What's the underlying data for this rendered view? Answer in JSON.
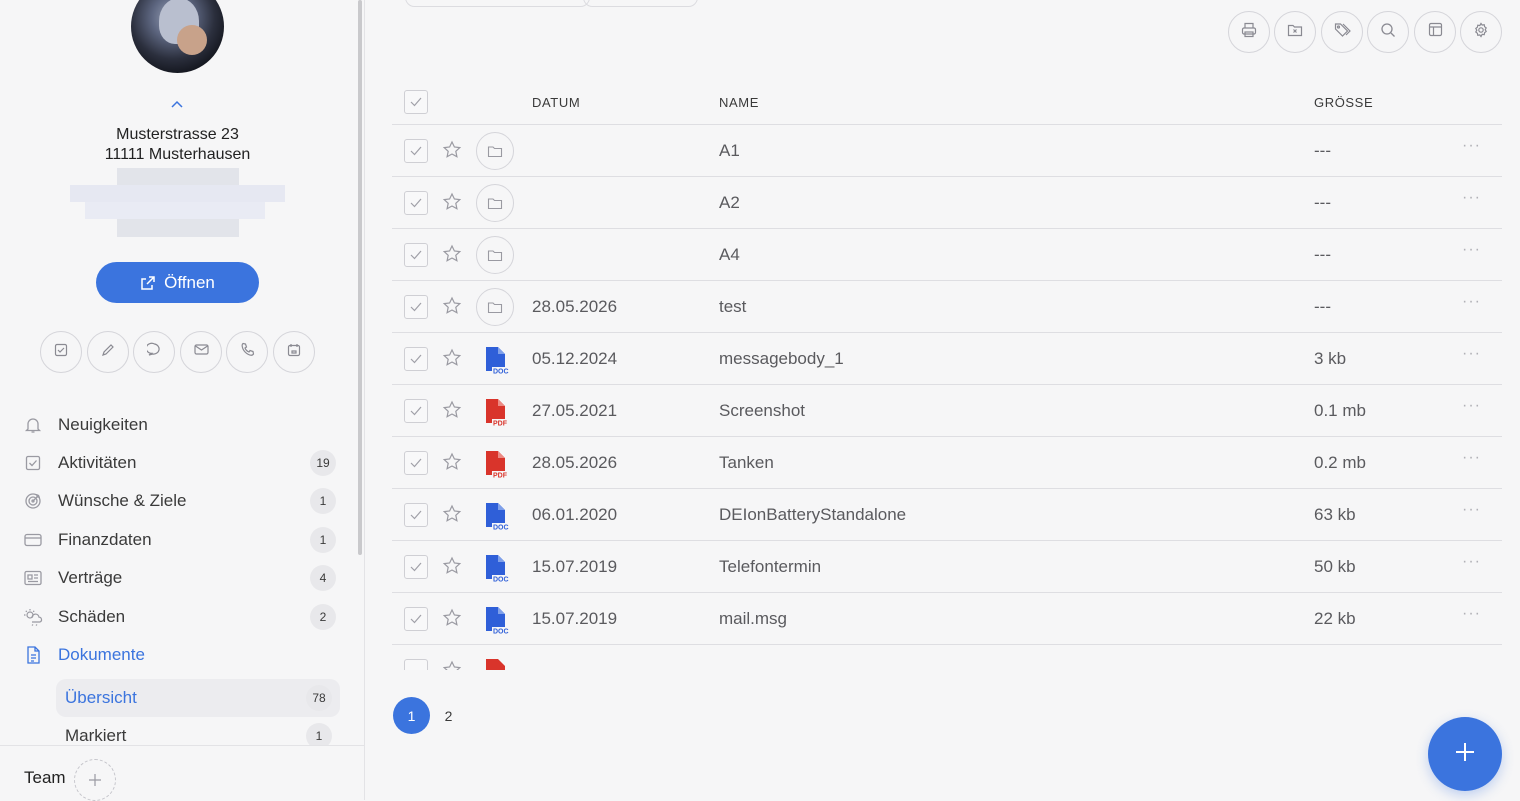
{
  "contact": {
    "address_line1": "Musterstrasse 23",
    "address_line2": "11111 Musterhausen",
    "open_button": "Öffnen"
  },
  "quick_actions": [
    "check-icon",
    "pencil-icon",
    "chat-icon",
    "mail-icon",
    "phone-icon",
    "calendar-icon"
  ],
  "nav": {
    "items": [
      {
        "label": "Neuigkeiten",
        "icon": "bell-icon",
        "badge": ""
      },
      {
        "label": "Aktivitäten",
        "icon": "checkbox-icon",
        "badge": "19"
      },
      {
        "label": "Wünsche & Ziele",
        "icon": "target-icon",
        "badge": "1"
      },
      {
        "label": "Finanzdaten",
        "icon": "card-icon",
        "badge": "1"
      },
      {
        "label": "Verträge",
        "icon": "contract-icon",
        "badge": "4"
      },
      {
        "label": "Schäden",
        "icon": "weather-icon",
        "badge": "2"
      },
      {
        "label": "Dokumente",
        "icon": "document-icon",
        "badge": ""
      }
    ],
    "sub_items": [
      {
        "label": "Übersicht",
        "badge": "78"
      },
      {
        "label": "Markiert",
        "badge": "1"
      }
    ],
    "team_label": "Team"
  },
  "toolbar": [
    "print-icon",
    "folder-x-icon",
    "tags-icon",
    "search-icon",
    "layout-icon",
    "gear-icon"
  ],
  "table": {
    "headers": {
      "date": "DATUM",
      "name": "NAME",
      "size": "GRÖSSE"
    },
    "rows": [
      {
        "type": "folder",
        "date": "",
        "name": "A1",
        "size": "---"
      },
      {
        "type": "folder",
        "date": "",
        "name": "A2",
        "size": "---"
      },
      {
        "type": "folder",
        "date": "",
        "name": "A4",
        "size": "---"
      },
      {
        "type": "folder",
        "date": "28.05.2026",
        "name": "test",
        "size": "---"
      },
      {
        "type": "doc",
        "date": "05.12.2024",
        "name": "messagebody_1",
        "size": "3 kb"
      },
      {
        "type": "pdf",
        "date": "27.05.2021",
        "name": "Screenshot",
        "size": "0.1 mb"
      },
      {
        "type": "pdf",
        "date": "28.05.2026",
        "name": "Tanken",
        "size": "0.2 mb"
      },
      {
        "type": "doc",
        "date": "06.01.2020",
        "name": "DEIonBatteryStandalone",
        "size": "63 kb"
      },
      {
        "type": "doc",
        "date": "15.07.2019",
        "name": "Telefontermin",
        "size": "50 kb"
      },
      {
        "type": "doc",
        "date": "15.07.2019",
        "name": "mail.msg",
        "size": "22 kb"
      },
      {
        "type": "pdf",
        "date": "",
        "name": "",
        "size": ""
      }
    ]
  },
  "pagination": {
    "pages": [
      "1",
      "2"
    ],
    "current": "1"
  },
  "colors": {
    "accent": "#3b74de",
    "pdf": "#d9342b",
    "doc": "#2f5fd8"
  }
}
